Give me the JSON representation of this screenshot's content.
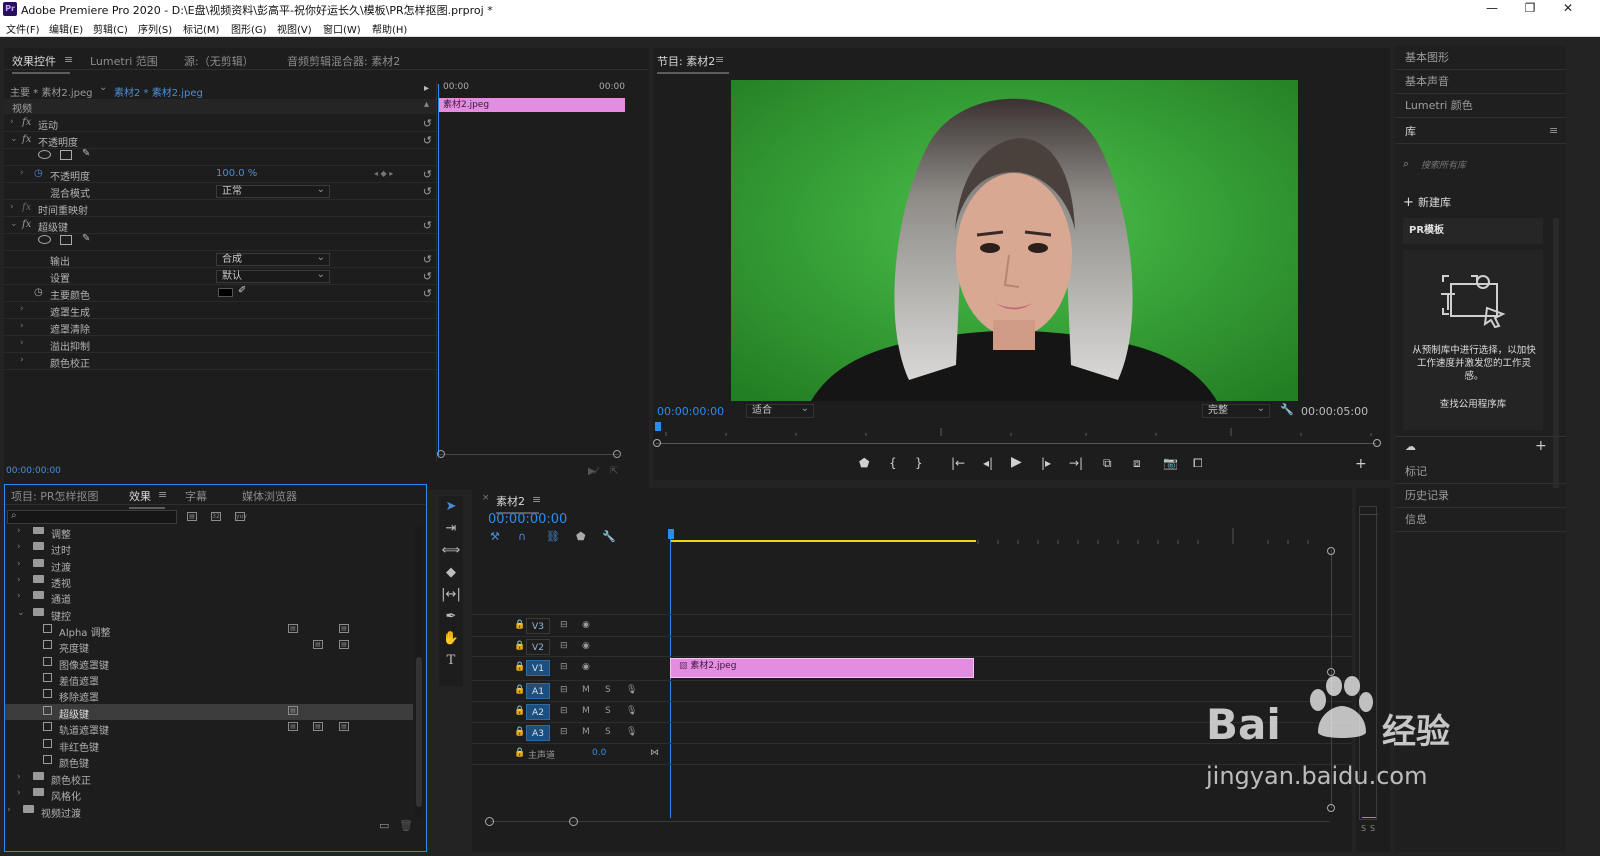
{
  "window": {
    "title": "Adobe Premiere Pro 2020 - D:\\E盘\\视频资料\\彭高平-祝你好运长久\\模板\\PR怎样抠图.prproj *",
    "icon": "Pr"
  },
  "menu": [
    "文件(F)",
    "编辑(E)",
    "剪辑(C)",
    "序列(S)",
    "标记(M)",
    "图形(G)",
    "视图(V)",
    "窗口(W)",
    "帮助(H)"
  ],
  "effect_controls": {
    "tabs": [
      "效果控件",
      "Lumetri 范围",
      "源:（无剪辑）",
      "音频剪辑混合器: 素材2"
    ],
    "master": "主要 * 素材2.jpeg",
    "clip": "素材2 * 素材2.jpeg",
    "time_start": "00:00",
    "time_end": "00:00",
    "clip_bar": "素材2.jpeg",
    "section": "视频",
    "rows": {
      "motion": "运动",
      "opacity": "不透明度",
      "opacity_prop": "不透明度",
      "opacity_val": "100.0 %",
      "blend": "混合模式",
      "blend_val": "正常",
      "timeremap": "时间重映射",
      "ultrakey": "超级键",
      "output": "输出",
      "output_val": "合成",
      "setting": "设置",
      "setting_val": "默认",
      "keycolor": "主要颜色",
      "matte_gen": "遮罩生成",
      "matte_clean": "遮罩清除",
      "spill": "溢出抑制",
      "color_corr": "颜色校正"
    },
    "fx": "fx",
    "timecode": "00:00:00:00"
  },
  "program": {
    "title": "节目: 素材2",
    "timecode": "00:00:00:00",
    "fit": "适合",
    "quality": "完整",
    "duration": "00:00:05:00"
  },
  "project": {
    "tabs": [
      "项目: PR怎样抠图",
      "效果",
      "字幕",
      "媒体浏览器"
    ],
    "tree": [
      "调整",
      "过时",
      "过渡",
      "透视",
      "通道",
      "键控",
      "Alpha 调整",
      "亮度键",
      "图像遮罩键",
      "差值遮罩",
      "移除遮罩",
      "超级键",
      "轨道遮罩键",
      "非红色键",
      "颜色键",
      "颜色校正",
      "风格化",
      "视频过渡"
    ]
  },
  "timeline": {
    "title": "素材2",
    "timecode": "00:00:00:00",
    "tracks": [
      "V3",
      "V2",
      "V1",
      "A1",
      "A2",
      "A3"
    ],
    "master": "主声道",
    "master_val": "0.0",
    "clip": "素材2.jpeg",
    "mute": "M",
    "solo": "S"
  },
  "right_panel": {
    "items": [
      "基本图形",
      "基本声音",
      "Lumetri 颜色"
    ],
    "library": "库",
    "search_placeholder": "搜索所有库",
    "new_lib": "新建库",
    "lib_name": "PR模板",
    "lib_desc": "从预制库中进行选择，以加快工作速度并激发您的工作灵感。",
    "lib_link": "查找公用程序库",
    "bottom": [
      "标记",
      "历史记录",
      "信息"
    ]
  },
  "meter_labels": [
    "S",
    "S"
  ],
  "watermark": {
    "brand": "Bai",
    "brand2": "经验",
    "url": "jingyan.baidu.com"
  },
  "colors": {
    "accent": "#2d8ceb",
    "clip": "#e38ce0",
    "green": "#3aa13a",
    "playhead": "#4b8ed6"
  }
}
